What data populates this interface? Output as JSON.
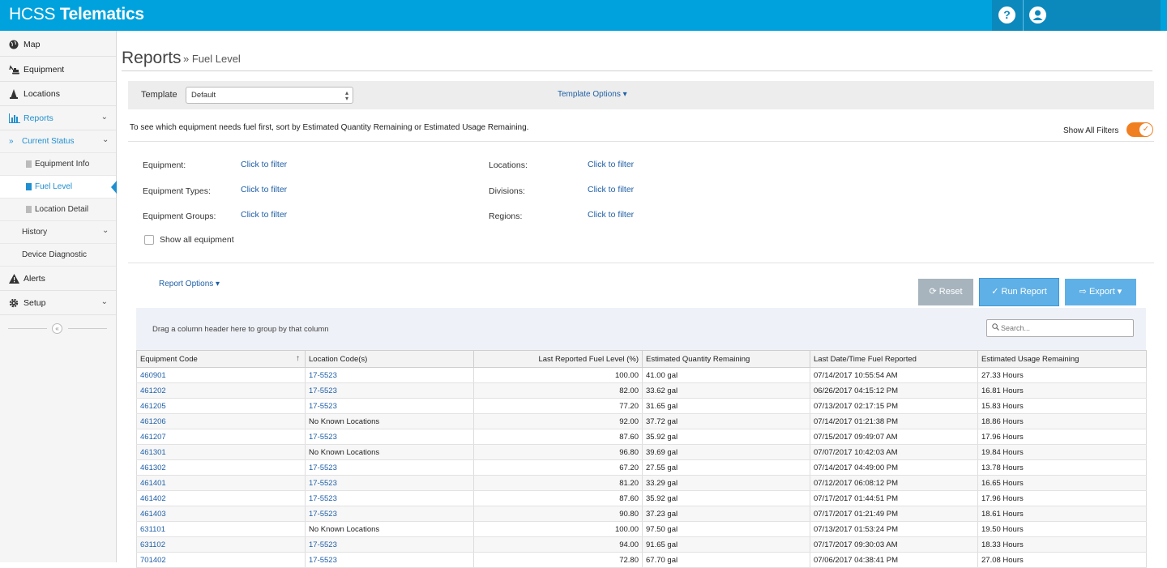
{
  "header": {
    "brand_light": "HCSS",
    "brand_bold": "Telematics",
    "help_icon": "?",
    "user_icon": "user"
  },
  "sidebar": {
    "items": [
      {
        "label": "Map",
        "icon": "globe-icon"
      },
      {
        "label": "Equipment",
        "icon": "excavator-icon"
      },
      {
        "label": "Locations",
        "icon": "cone-icon"
      },
      {
        "label": "Reports",
        "icon": "bar-chart-icon"
      },
      {
        "label": "Alerts",
        "icon": "warning-icon"
      },
      {
        "label": "Setup",
        "icon": "gear-icon"
      }
    ],
    "sub": {
      "current_status": "Current Status",
      "equipment_info": "Equipment Info",
      "fuel_level": "Fuel Level",
      "location_detail": "Location Detail",
      "history": "History",
      "device_diagnostic": "Device Diagnostic"
    }
  },
  "page": {
    "title": "Reports",
    "breadcrumb": "» Fuel Level"
  },
  "template": {
    "label": "Template",
    "value": "Default",
    "options_label": "Template Options"
  },
  "hint": "To see which equipment needs fuel first, sort by Estimated Quantity Remaining or Estimated Usage Remaining.",
  "show_all_filters": "Show All Filters",
  "filters": {
    "equipment": "Equipment:",
    "equipment_types": "Equipment Types:",
    "equipment_groups": "Equipment Groups:",
    "locations": "Locations:",
    "divisions": "Divisions:",
    "regions": "Regions:",
    "link": "Click to filter",
    "show_all_equipment": "Show all equipment"
  },
  "report_options": "Report Options",
  "buttons": {
    "reset": "Reset",
    "run": "Run Report",
    "export": "Export"
  },
  "grid": {
    "drag_hint": "Drag a column header here to group by that column",
    "search_placeholder": "Search...",
    "columns": [
      "Equipment Code",
      "Location Code(s)",
      "Last Reported Fuel Level (%)",
      "Estimated Quantity Remaining",
      "Last Date/Time Fuel Reported",
      "Estimated Usage Remaining"
    ],
    "rows": [
      [
        "460901",
        "17-5523",
        "100.00",
        "41.00 gal",
        "07/14/2017 10:55:54 AM",
        "27.33 Hours"
      ],
      [
        "461202",
        "17-5523",
        "82.00",
        "33.62 gal",
        "06/26/2017 04:15:12 PM",
        "16.81 Hours"
      ],
      [
        "461205",
        "17-5523",
        "77.20",
        "31.65 gal",
        "07/13/2017 02:17:15 PM",
        "15.83 Hours"
      ],
      [
        "461206",
        "No Known Locations",
        "92.00",
        "37.72 gal",
        "07/14/2017 01:21:38 PM",
        "18.86 Hours"
      ],
      [
        "461207",
        "17-5523",
        "87.60",
        "35.92 gal",
        "07/15/2017 09:49:07 AM",
        "17.96 Hours"
      ],
      [
        "461301",
        "No Known Locations",
        "96.80",
        "39.69 gal",
        "07/07/2017 10:42:03 AM",
        "19.84 Hours"
      ],
      [
        "461302",
        "17-5523",
        "67.20",
        "27.55 gal",
        "07/14/2017 04:49:00 PM",
        "13.78 Hours"
      ],
      [
        "461401",
        "17-5523",
        "81.20",
        "33.29 gal",
        "07/12/2017 06:08:12 PM",
        "16.65 Hours"
      ],
      [
        "461402",
        "17-5523",
        "87.60",
        "35.92 gal",
        "07/17/2017 01:44:51 PM",
        "17.96 Hours"
      ],
      [
        "461403",
        "17-5523",
        "90.80",
        "37.23 gal",
        "07/17/2017 01:21:49 PM",
        "18.61 Hours"
      ],
      [
        "631101",
        "No Known Locations",
        "100.00",
        "97.50 gal",
        "07/13/2017 01:53:24 PM",
        "19.50 Hours"
      ],
      [
        "631102",
        "17-5523",
        "94.00",
        "91.65 gal",
        "07/17/2017 09:30:03 AM",
        "18.33 Hours"
      ],
      [
        "701402",
        "17-5523",
        "72.80",
        "67.70 gal",
        "07/06/2017 04:38:41 PM",
        "27.08 Hours"
      ]
    ]
  }
}
